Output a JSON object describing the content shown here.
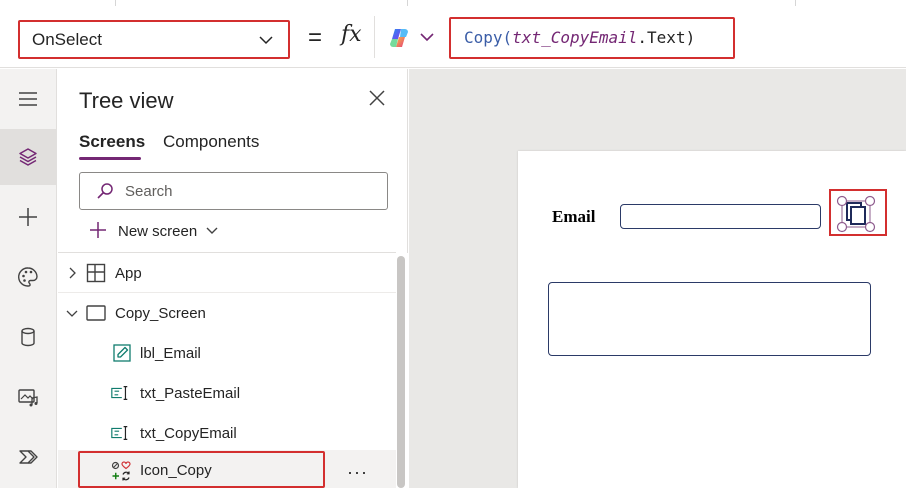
{
  "formula_bar": {
    "property": "OnSelect",
    "equals": "=",
    "fx": "fx",
    "formula": {
      "fn": "Copy(",
      "control": "txt_CopyEmail",
      "prop": ".Text)"
    }
  },
  "rail": {
    "items": [
      "menu-icon",
      "layers-icon",
      "add-icon",
      "palette-icon",
      "database-icon",
      "media-icon",
      "power-automate-icon"
    ],
    "active": "layers-icon"
  },
  "tree_view": {
    "title": "Tree view",
    "tabs": [
      {
        "label": "Screens",
        "active": true
      },
      {
        "label": "Components",
        "active": false
      }
    ],
    "search_placeholder": "Search",
    "new_screen_label": "New screen",
    "nodes": [
      {
        "label": "App",
        "icon": "app-grid-icon",
        "caret": "right"
      },
      {
        "label": "Copy_Screen",
        "icon": "screen-icon",
        "caret": "down"
      },
      {
        "label": "lbl_Email",
        "icon": "label-edit-icon"
      },
      {
        "label": "txt_PasteEmail",
        "icon": "text-input-icon"
      },
      {
        "label": "txt_CopyEmail",
        "icon": "text-input-icon"
      },
      {
        "label": "Icon_Copy",
        "icon": "icon-control-icon",
        "selected": true
      }
    ],
    "more_label": "···"
  },
  "canvas": {
    "email_label": "Email"
  },
  "colors": {
    "accent": "#742774",
    "highlight": "#d32f2f",
    "input_border": "#2b3a67",
    "canvas_bg": "#e9e8e6"
  }
}
